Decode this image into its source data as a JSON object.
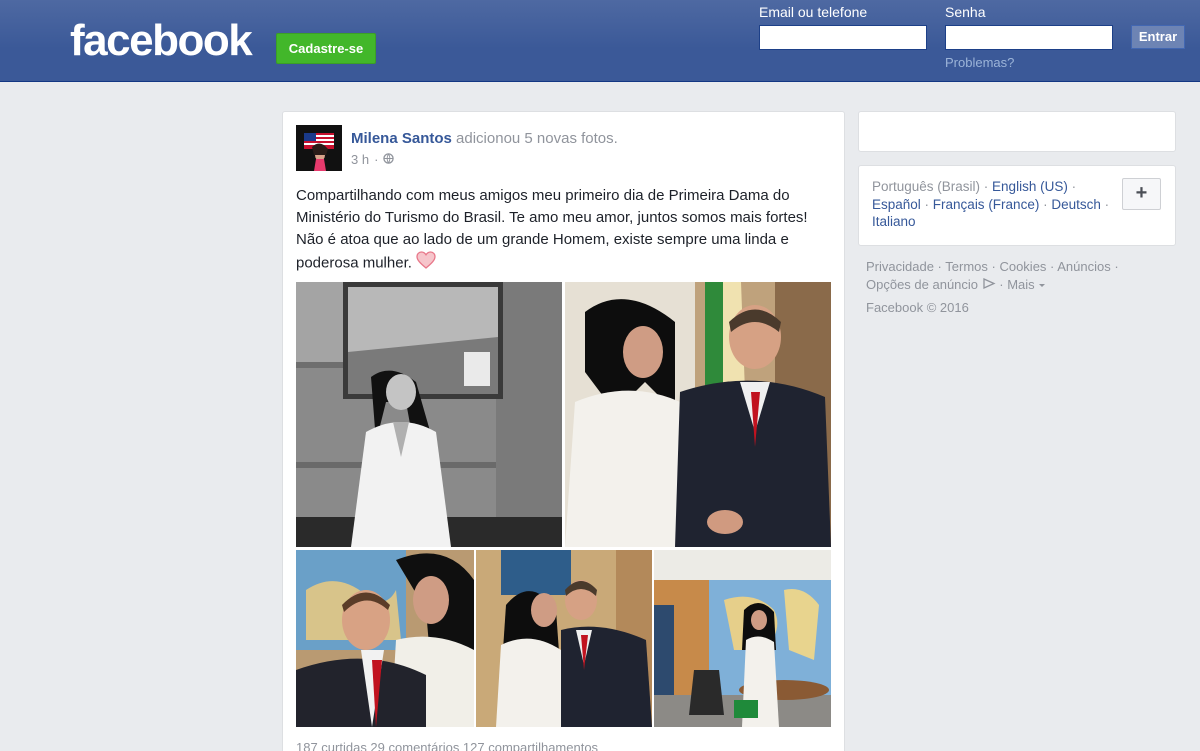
{
  "header": {
    "logo": "facebook",
    "signup_label": "Cadastre-se",
    "email_label": "Email ou telefone",
    "password_label": "Senha",
    "login_label": "Entrar",
    "forgot_label": "Problemas?",
    "email_value": "",
    "password_value": ""
  },
  "post": {
    "author": "Milena Santos",
    "action": "adicionou 5 novas fotos.",
    "time": "3 h",
    "privacy_icon": "globe-icon",
    "text": "Compartilhando com meus amigos meu primeiro dia de Primeira Dama do Ministério do Turismo do Brasil. Te amo meu amor, juntos somos mais fortes! Não é atoa que ao lado de um grande Homem, existe sempre uma linda e poderosa mulher.",
    "emoji": "heart-icon",
    "photos_count": 5,
    "stats": "187 curtidas  29 comentários  127 compartilhamentos"
  },
  "sidebar": {
    "languages": {
      "current": "Português (Brasil)",
      "options": [
        "English (US)",
        "Español",
        "Français (France)",
        "Deutsch",
        "Italiano"
      ]
    },
    "add_language_label": "+",
    "footer_links": [
      "Privacidade",
      "Termos",
      "Cookies",
      "Anúncios",
      "Opções de anúncio",
      "Mais"
    ],
    "copyright": "Facebook © 2016"
  },
  "colors": {
    "brand": "#3b5998",
    "signup": "#42b72a",
    "link": "#365899",
    "muted": "#90949c",
    "background": "#e9ebee"
  }
}
